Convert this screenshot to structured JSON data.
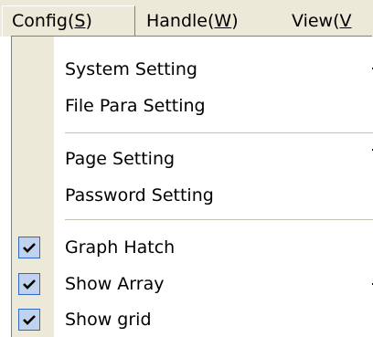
{
  "menubar": {
    "items": [
      {
        "prefix": "Config(",
        "accel": "S",
        "suffix": ")"
      },
      {
        "prefix": "Handle(",
        "accel": "W",
        "suffix": ")"
      },
      {
        "prefix": "View(",
        "accel": "V",
        "suffix": ""
      }
    ]
  },
  "config_menu": {
    "items": [
      {
        "label": "System Setting"
      },
      {
        "label": "File Para Setting"
      },
      {
        "label": "Page Setting"
      },
      {
        "label": "Password Setting"
      },
      {
        "label": "Graph Hatch",
        "checked": true
      },
      {
        "label": "Show Array",
        "checked": true
      },
      {
        "label": "Show grid",
        "checked": true
      }
    ]
  },
  "icons": {
    "checked": "checkmark-icon"
  },
  "colors": {
    "menubar_bg": "#ece9d8",
    "menu_bg": "#ffffff",
    "gutter_bg": "#ece9d8",
    "check_highlight": "#c1d2ee",
    "check_border": "#316ac5",
    "separator": "#c5c2b2"
  }
}
